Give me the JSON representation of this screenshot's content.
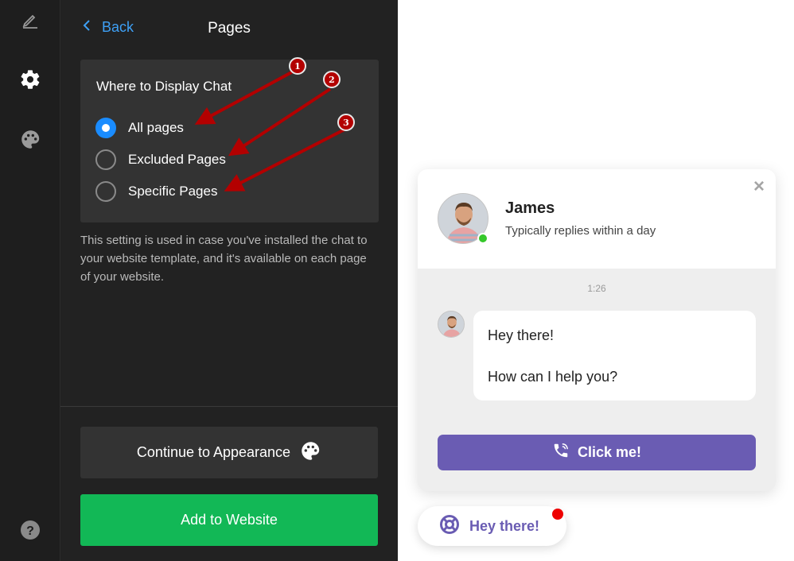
{
  "nav": {
    "back_label": "Back",
    "title": "Pages",
    "rail_icons": [
      "edit-icon",
      "gear-icon",
      "palette-icon",
      "help-icon"
    ]
  },
  "display_card": {
    "heading": "Where to Display Chat",
    "options": [
      {
        "label": "All pages",
        "selected": true
      },
      {
        "label": "Excluded Pages",
        "selected": false
      },
      {
        "label": "Specific Pages",
        "selected": false
      }
    ],
    "description": "This setting is used in case you've installed the chat to your website template, and it's available on each page of your website."
  },
  "annotations": [
    "1",
    "2",
    "3"
  ],
  "buttons": {
    "continue_label": "Continue to Appearance",
    "add_label": "Add to Website"
  },
  "chat": {
    "agent_name": "James",
    "status": "Typically replies within a day",
    "timestamp": "1:26",
    "message_lines": [
      "Hey there!",
      "How can I help you?"
    ],
    "cta_label": "Click me!",
    "close_symbol": "×"
  },
  "launcher": {
    "label": "Hey there!"
  },
  "colors": {
    "accent_blue": "#1a8cff",
    "add_green": "#12b856",
    "chat_purple": "#6a5cb3",
    "annotation_red": "#b30000",
    "online_green": "#35c82a"
  }
}
